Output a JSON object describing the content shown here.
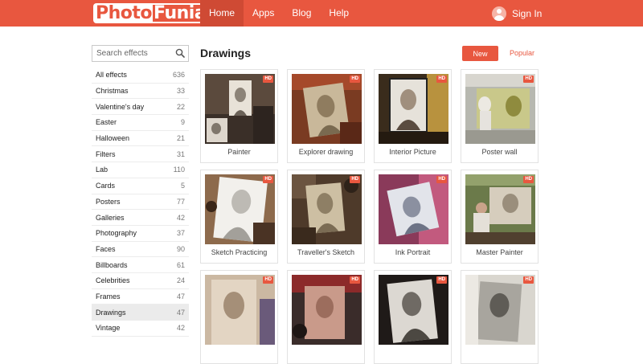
{
  "header": {
    "logo_part1": "Photo",
    "logo_part2": "Funia",
    "nav": [
      {
        "label": "Home",
        "active": true
      },
      {
        "label": "Apps"
      },
      {
        "label": "Blog"
      },
      {
        "label": "Help"
      }
    ],
    "signin_label": "Sign In"
  },
  "sidebar": {
    "search_placeholder": "Search effects",
    "categories": [
      {
        "label": "All effects",
        "count": "636"
      },
      {
        "label": "Christmas",
        "count": "33"
      },
      {
        "label": "Valentine's day",
        "count": "22"
      },
      {
        "label": "Easter",
        "count": "9"
      },
      {
        "label": "Halloween",
        "count": "21"
      },
      {
        "label": "Filters",
        "count": "31"
      },
      {
        "label": "Lab",
        "count": "110"
      },
      {
        "label": "Cards",
        "count": "5"
      },
      {
        "label": "Posters",
        "count": "77"
      },
      {
        "label": "Galleries",
        "count": "42"
      },
      {
        "label": "Photography",
        "count": "37"
      },
      {
        "label": "Faces",
        "count": "90"
      },
      {
        "label": "Billboards",
        "count": "61"
      },
      {
        "label": "Celebrities",
        "count": "24"
      },
      {
        "label": "Frames",
        "count": "47"
      },
      {
        "label": "Drawings",
        "count": "47",
        "active": true
      },
      {
        "label": "Vintage",
        "count": "42"
      }
    ]
  },
  "main": {
    "title": "Drawings",
    "new_label": "New",
    "popular_label": "Popular",
    "hd_badge": "HD",
    "effects": [
      {
        "label": "Painter"
      },
      {
        "label": "Explorer drawing"
      },
      {
        "label": "Interior Picture"
      },
      {
        "label": "Poster wall"
      },
      {
        "label": "Sketch Practicing"
      },
      {
        "label": "Traveller's Sketch"
      },
      {
        "label": "Ink Portrait"
      },
      {
        "label": "Master Painter"
      },
      {
        "label": ""
      },
      {
        "label": ""
      },
      {
        "label": ""
      },
      {
        "label": ""
      }
    ]
  },
  "colors": {
    "brand": "#e8573f",
    "brand_dark": "#cf4a34"
  }
}
